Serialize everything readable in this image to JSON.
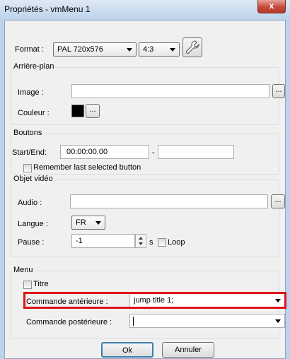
{
  "window": {
    "title": "Propriétés - vmMenu 1",
    "close_label": "x"
  },
  "format": {
    "label": "Format :",
    "format_value": "PAL 720x576",
    "aspect_value": "4:3",
    "settings_icon": "wrench-icon"
  },
  "background": {
    "group_label": "Arrière-plan",
    "image_label": "Image :",
    "image_value": "",
    "browse_label": "...",
    "color_label": "Couleur :",
    "color_value": "#000000",
    "color_browse_label": "..."
  },
  "buttons": {
    "group_label": "Boutons",
    "start_end_label": "Start/End:",
    "start_value": "00:00:00.00",
    "separator": "-",
    "end_value": "",
    "remember_label": "Remember last selected button",
    "remember_checked": false
  },
  "video": {
    "group_label": "Objet vidéo",
    "audio_label": "Audio :",
    "audio_value": "",
    "audio_browse_label": "...",
    "language_label": "Langue :",
    "language_value": "FR",
    "pause_label": "Pause :",
    "pause_value": "-1",
    "pause_unit": "s",
    "loop_label": "Loop",
    "loop_checked": false
  },
  "menu": {
    "group_label": "Menu",
    "title_label": "Titre",
    "title_checked": false,
    "pre_command_label": "Commande antérieure :",
    "pre_command_value": "jump title 1;",
    "post_command_label": "Commande postérieure :",
    "post_command_value": ""
  },
  "footer": {
    "ok_label": "Ok",
    "cancel_label": "Annuler"
  },
  "colors": {
    "highlight": "#e0121a",
    "window_frame": "#bcd3ec"
  }
}
